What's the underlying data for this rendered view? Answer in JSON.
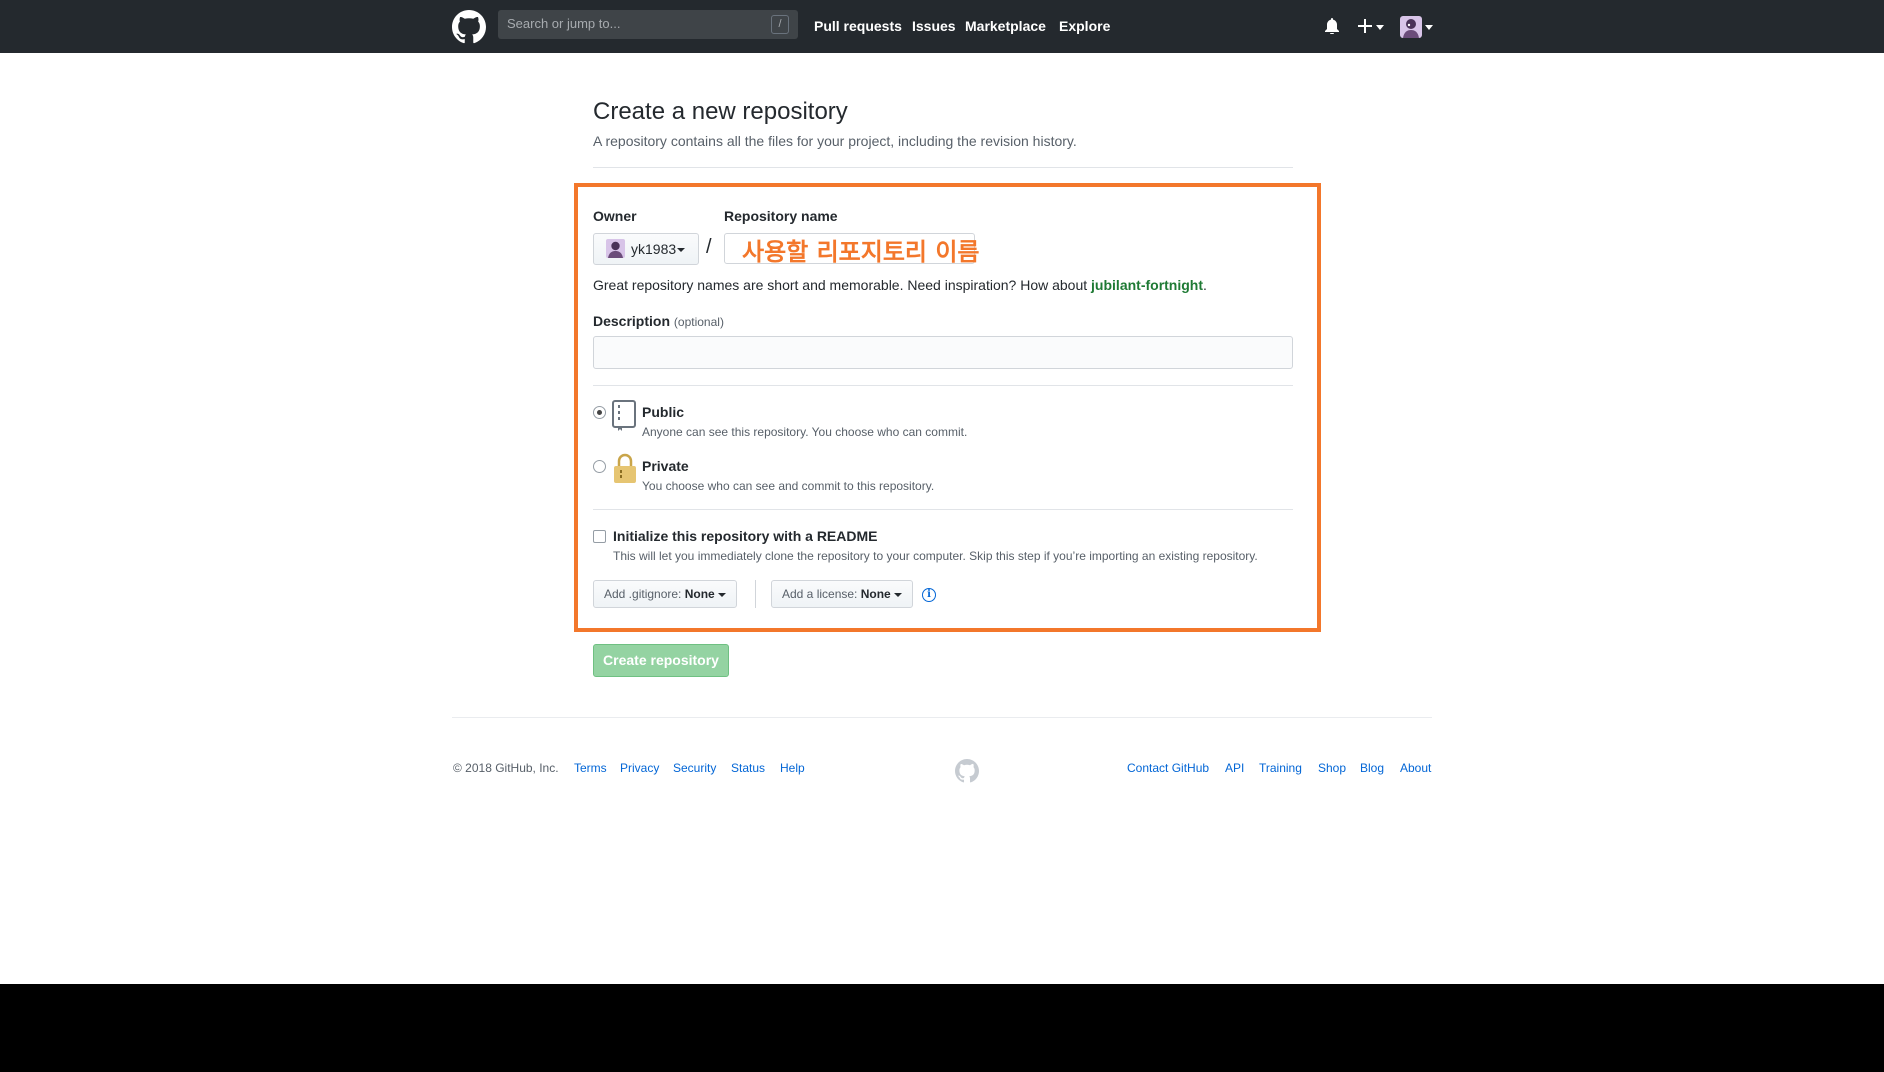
{
  "header": {
    "search_placeholder": "Search or jump to...",
    "search_shortcut": "/",
    "nav": [
      "Pull requests",
      "Issues",
      "Marketplace",
      "Explore"
    ]
  },
  "page": {
    "title": "Create a new repository",
    "subtitle": "A repository contains all the files for your project, including the revision history."
  },
  "form": {
    "owner_label": "Owner",
    "owner_value": "yk1983",
    "separator": "/",
    "repo_name_label": "Repository name",
    "repo_name_annotation": "사용할 리포지토리 이름",
    "name_hint_prefix": "Great repository names are short and memorable. Need inspiration? How about",
    "name_suggestion": "jubilant-fortnight",
    "name_hint_suffix": ".",
    "description_label": "Description",
    "description_optional": "(optional)",
    "description_value": "",
    "visibility": [
      {
        "title": "Public",
        "desc": "Anyone can see this repository. You choose who can commit.",
        "selected": true
      },
      {
        "title": "Private",
        "desc": "You choose who can see and commit to this repository.",
        "selected": false
      }
    ],
    "readme_label": "Initialize this repository with a README",
    "readme_desc": "This will let you immediately clone the repository to your computer. Skip this step if you’re importing an existing repository.",
    "gitignore_prefix": "Add .gitignore:",
    "gitignore_value": "None",
    "license_prefix": "Add a license:",
    "license_value": "None",
    "info_glyph": "i",
    "submit_label": "Create repository"
  },
  "footer": {
    "copyright": "© 2018 GitHub, Inc.",
    "left_links": [
      "Terms",
      "Privacy",
      "Security",
      "Status",
      "Help"
    ],
    "right_links": [
      "Contact GitHub",
      "API",
      "Training",
      "Shop",
      "Blog",
      "About"
    ]
  },
  "colors": {
    "header_bg": "#24292e",
    "annotation": "#f3772b",
    "link": "#0366d6",
    "submit_disabled": "#94d3a2"
  }
}
